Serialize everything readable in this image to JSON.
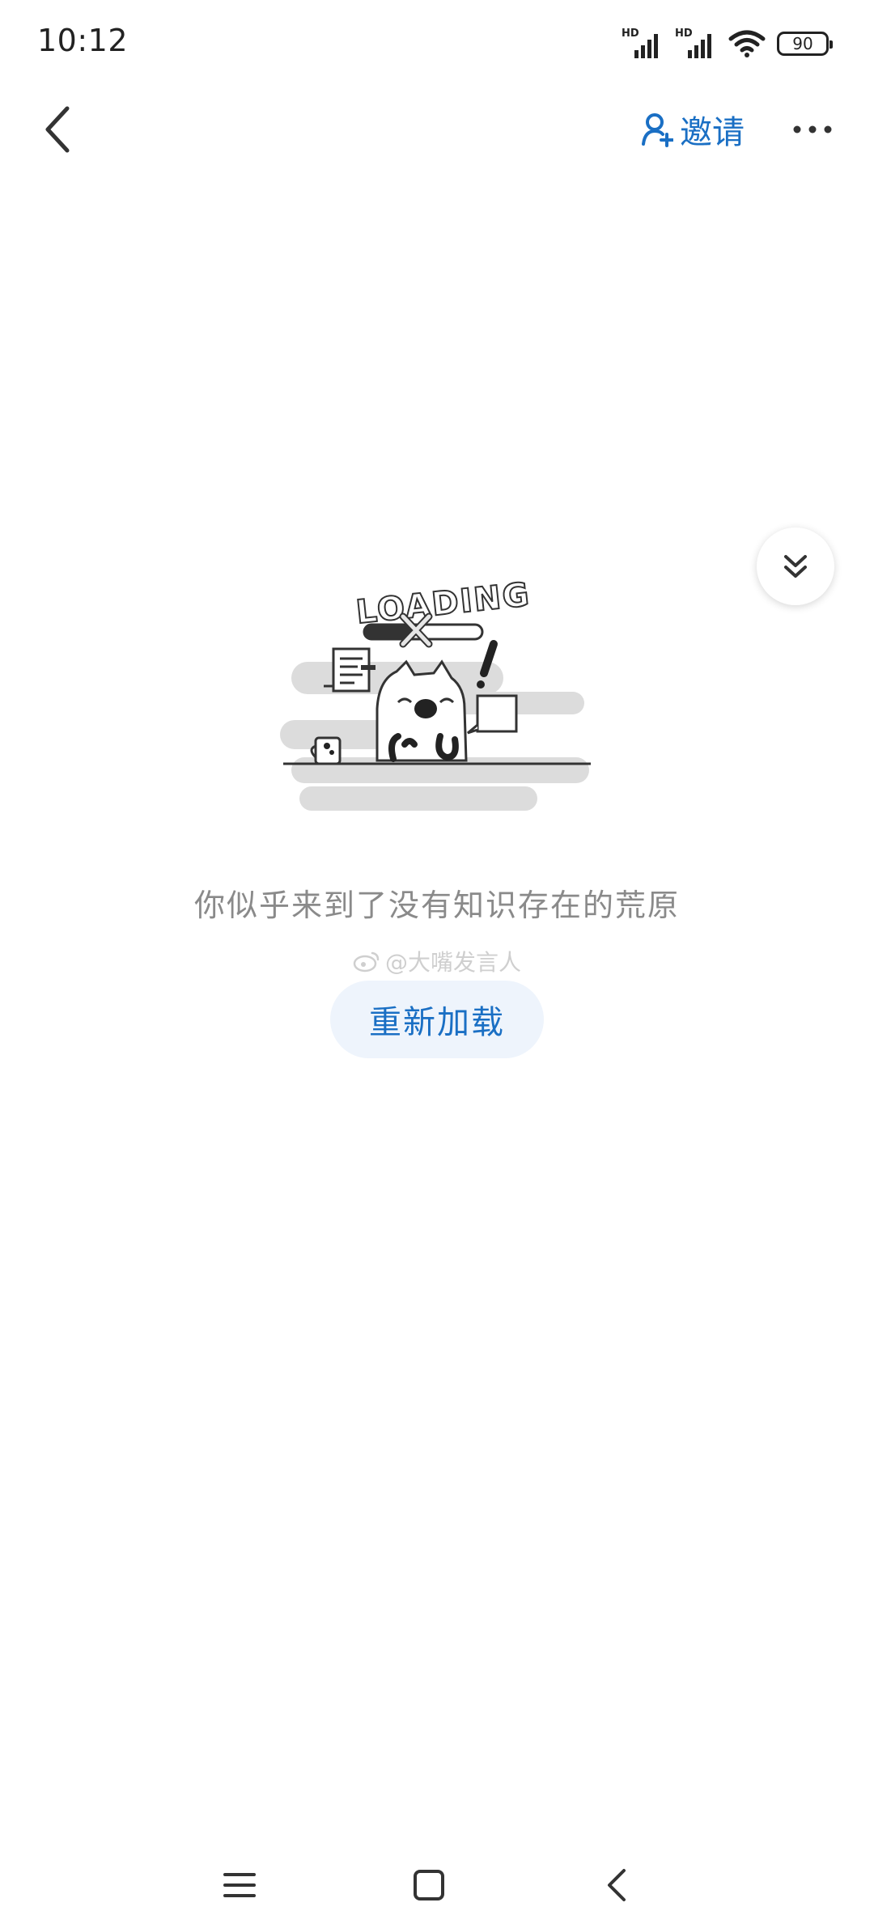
{
  "status_bar": {
    "time": "10:12",
    "signal_1_label": "HD",
    "signal_2_label": "HD",
    "battery_level": "90"
  },
  "nav": {
    "back_icon": "chevron-left-icon",
    "invite_label": "邀请",
    "invite_icon": "person-add-icon",
    "more_icon": "more-horizontal-icon"
  },
  "fab": {
    "icon": "double-chevron-down-icon"
  },
  "illustration": {
    "loading_text": "LOADING",
    "description": "loading-cat-illustration"
  },
  "empty_state": {
    "message": "你似乎来到了没有知识存在的荒原",
    "watermark": "@大嘴发言人",
    "reload_label": "重新加载"
  },
  "system_nav": {
    "menu_icon": "menu-icon",
    "home_icon": "home-square-icon",
    "back_icon": "back-chevron-icon"
  },
  "colors": {
    "accent": "#1a6fc4",
    "reload_bg": "#eef4fc",
    "message_text": "#8a8a8a"
  }
}
